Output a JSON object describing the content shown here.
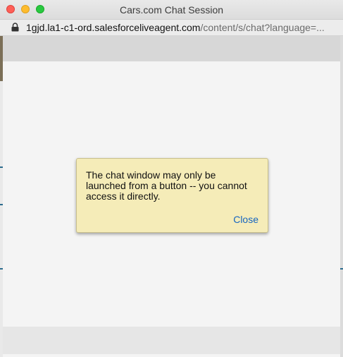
{
  "window": {
    "title": "Cars.com Chat Session"
  },
  "urlbar": {
    "host": "1gjd.la1-c1-ord.salesforceliveagent.com",
    "path": "/content/s/chat?language=..."
  },
  "dialog": {
    "message": "The chat window may only be launched from a button -- you cannot access it directly.",
    "close_label": "Close"
  },
  "icons": {
    "close": "close-window-icon",
    "minimize": "minimize-window-icon",
    "maximize": "maximize-window-icon",
    "lock": "lock-icon"
  }
}
